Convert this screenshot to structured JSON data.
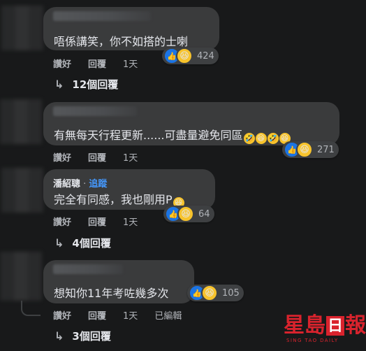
{
  "comments": [
    {
      "author": "",
      "text": "唔係講笑，你不如搭的士喇",
      "reaction_count": "424",
      "actions": {
        "like": "讚好",
        "reply": "回覆",
        "time": "1天"
      },
      "replies_label": "12個回覆"
    },
    {
      "author": "",
      "text": "有無每天行程更新......可盡量避免同區",
      "reaction_count": "271",
      "actions": {
        "like": "讚好",
        "reply": "回覆",
        "time": "1天"
      }
    },
    {
      "author": "潘紹聰",
      "follow": "追蹤",
      "text": "完全有同感，我也剛用P",
      "reaction_count": "64",
      "actions": {
        "like": "讚好",
        "reply": "回覆",
        "time": "1天"
      },
      "replies_label": "4個回覆"
    },
    {
      "author": "",
      "text": "想知你11年考咗幾多次",
      "reaction_count": "105",
      "actions": {
        "like": "讚好",
        "reply": "回覆",
        "time": "1天",
        "edited": "已編輯"
      },
      "replies_label": "3個回覆"
    }
  ],
  "icons": {
    "reply_arrow": "↳",
    "like": "👍",
    "haha": "😆",
    "rofl": "🤣"
  },
  "logo": {
    "chars": [
      "星",
      "島",
      "日",
      "報"
    ],
    "sub": "SING TAO DAILY",
    "color": "#d9232d"
  },
  "colors": {
    "background": "#18191a",
    "bubble": "#3a3b3c",
    "text": "#e4e6eb",
    "muted": "#b0b3b8",
    "follow": "#4599ff"
  }
}
